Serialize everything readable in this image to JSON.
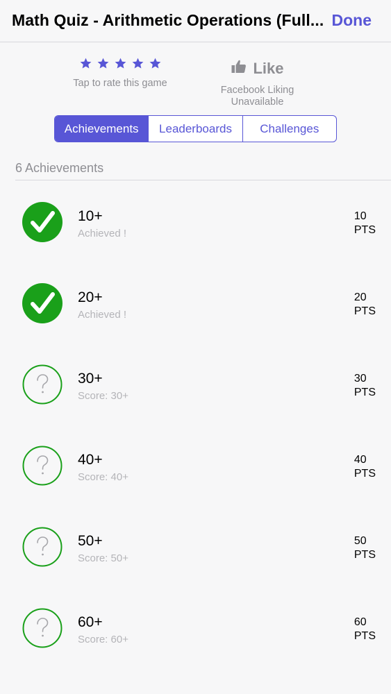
{
  "nav": {
    "title": "Math Quiz - Arithmetic Operations (Full...",
    "done_label": "Done"
  },
  "rating": {
    "stars": 5,
    "caption": "Tap to rate this game",
    "star_color": "#5856d6"
  },
  "like": {
    "label": "Like",
    "caption_line1": "Facebook Liking",
    "caption_line2": "Unavailable",
    "icon": "thumbs-up-icon"
  },
  "segments": [
    {
      "label": "Achievements",
      "active": true
    },
    {
      "label": "Leaderboards",
      "active": false
    },
    {
      "label": "Challenges",
      "active": false
    }
  ],
  "section": {
    "header": "6 Achievements"
  },
  "colors": {
    "accent": "#5856d6",
    "achieved_green": "#1aa01a"
  },
  "achievements": [
    {
      "title": "10+",
      "subtitle": "Achieved !",
      "points": "10",
      "points_unit": "PTS",
      "achieved": true
    },
    {
      "title": "20+",
      "subtitle": "Achieved !",
      "points": "20",
      "points_unit": "PTS",
      "achieved": true
    },
    {
      "title": "30+",
      "subtitle": "Score: 30+",
      "points": "30",
      "points_unit": "PTS",
      "achieved": false
    },
    {
      "title": "40+",
      "subtitle": "Score: 40+",
      "points": "40",
      "points_unit": "PTS",
      "achieved": false
    },
    {
      "title": "50+",
      "subtitle": "Score: 50+",
      "points": "50",
      "points_unit": "PTS",
      "achieved": false
    },
    {
      "title": "60+",
      "subtitle": "Score: 60+",
      "points": "60",
      "points_unit": "PTS",
      "achieved": false
    }
  ]
}
